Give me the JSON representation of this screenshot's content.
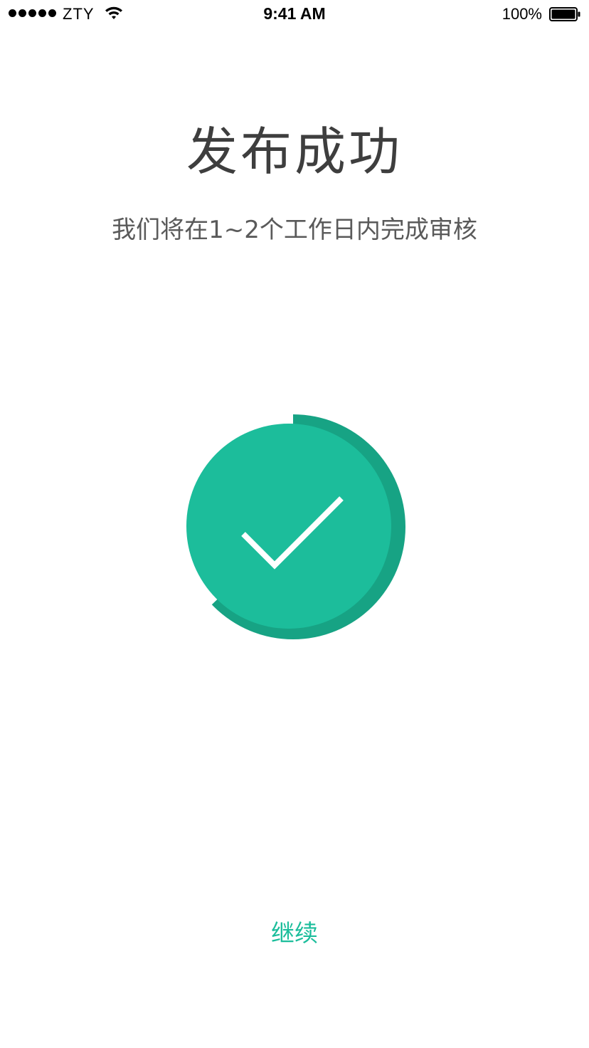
{
  "status_bar": {
    "carrier": "ZTY",
    "time": "9:41 AM",
    "battery_percent": "100%",
    "signal_icon": "signal-dots-icon",
    "wifi_icon": "wifi-icon",
    "battery_icon": "battery-icon"
  },
  "main": {
    "title": "发布成功",
    "subtitle": "我们将在1~2个工作日内完成审核",
    "success_icon": "checkmark-icon",
    "continue_label": "继续"
  },
  "colors": {
    "accent": "#1bbd9b",
    "accent_dark": "#17a384",
    "title_text": "#3e3e3e",
    "subtitle_text": "#5a5a5a"
  }
}
